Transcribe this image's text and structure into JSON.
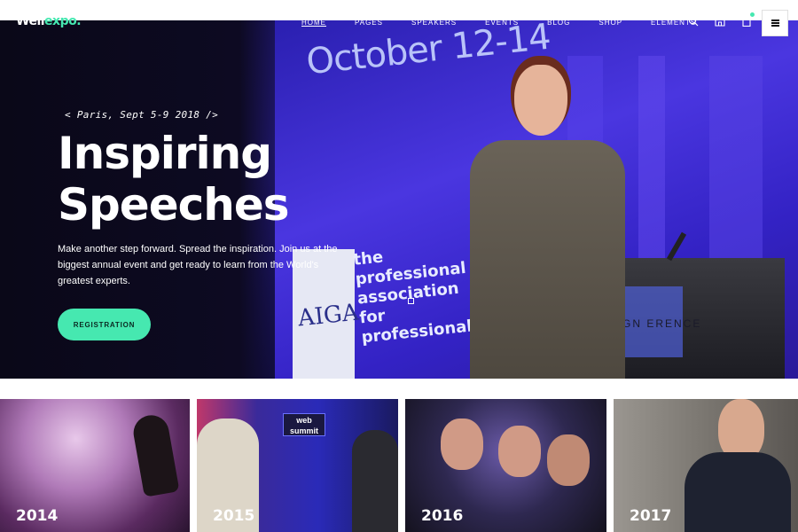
{
  "brand": {
    "name_part1": "Well",
    "name_part2": "expo.",
    "accent_color": "#46e8b0"
  },
  "nav": {
    "items": [
      {
        "label": "HOME",
        "active": true
      },
      {
        "label": "PAGES",
        "active": false
      },
      {
        "label": "SPEAKERS",
        "active": false
      },
      {
        "label": "EVENTS",
        "active": false
      },
      {
        "label": "BLOG",
        "active": false
      },
      {
        "label": "SHOP",
        "active": false
      },
      {
        "label": "ELEMENTS",
        "active": false
      }
    ],
    "icons": [
      "search-icon",
      "user-icon",
      "cart-icon",
      "menu-icon"
    ]
  },
  "hero": {
    "tagline": "< Paris, Sept 5-9 2018 />",
    "headline_line1": "Inspiring",
    "headline_line2": "Speeches",
    "description": "Make another step forward. Spread the inspiration. Join us at the biggest annual event and get ready to learn from the World's greatest experts.",
    "cta_label": "REGISTRATION",
    "background_text": {
      "date": "October 12-14",
      "logo": "AIGA",
      "tagline": "the professional association for professional",
      "podium": "GN ERENCE"
    }
  },
  "gallery": {
    "items": [
      {
        "year": "2014"
      },
      {
        "year": "2015",
        "sign": "web summit"
      },
      {
        "year": "2016"
      },
      {
        "year": "2017"
      }
    ]
  }
}
